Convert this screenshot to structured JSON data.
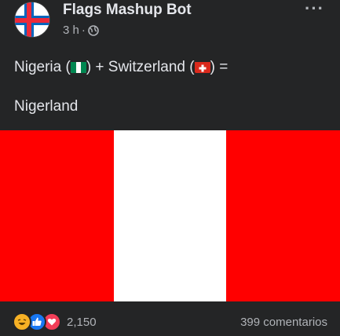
{
  "post": {
    "page_name": "Flags Mashup Bot",
    "time": "3 h",
    "separator": "·",
    "audience_icon": "globe-icon",
    "more_icon": "more-options-icon",
    "more_label": "···",
    "line1_a": "Nigeria (",
    "line1_b": ") + Switzerland (",
    "line1_c": ") =",
    "line2": "Nigerland",
    "flag_colors": {
      "red": "#ff0000",
      "white": "#ffffff",
      "green": "#008751"
    }
  },
  "footer": {
    "reaction_icons": [
      "haha-icon",
      "like-icon",
      "love-icon"
    ],
    "reaction_count": "2,150",
    "comments": "399 comentarios"
  }
}
